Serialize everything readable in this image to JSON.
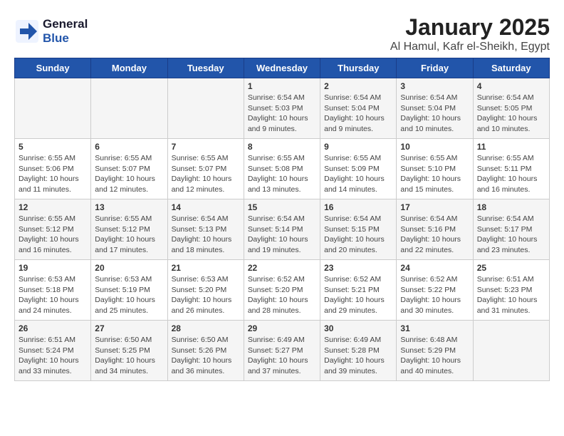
{
  "logo": {
    "general": "General",
    "blue": "Blue"
  },
  "header": {
    "title": "January 2025",
    "subtitle": "Al Hamul, Kafr el-Sheikh, Egypt"
  },
  "weekdays": [
    "Sunday",
    "Monday",
    "Tuesday",
    "Wednesday",
    "Thursday",
    "Friday",
    "Saturday"
  ],
  "weeks": [
    [
      {
        "day": "",
        "info": ""
      },
      {
        "day": "",
        "info": ""
      },
      {
        "day": "",
        "info": ""
      },
      {
        "day": "1",
        "info": "Sunrise: 6:54 AM\nSunset: 5:03 PM\nDaylight: 10 hours and 9 minutes."
      },
      {
        "day": "2",
        "info": "Sunrise: 6:54 AM\nSunset: 5:04 PM\nDaylight: 10 hours and 9 minutes."
      },
      {
        "day": "3",
        "info": "Sunrise: 6:54 AM\nSunset: 5:04 PM\nDaylight: 10 hours and 10 minutes."
      },
      {
        "day": "4",
        "info": "Sunrise: 6:54 AM\nSunset: 5:05 PM\nDaylight: 10 hours and 10 minutes."
      }
    ],
    [
      {
        "day": "5",
        "info": "Sunrise: 6:55 AM\nSunset: 5:06 PM\nDaylight: 10 hours and 11 minutes."
      },
      {
        "day": "6",
        "info": "Sunrise: 6:55 AM\nSunset: 5:07 PM\nDaylight: 10 hours and 12 minutes."
      },
      {
        "day": "7",
        "info": "Sunrise: 6:55 AM\nSunset: 5:07 PM\nDaylight: 10 hours and 12 minutes."
      },
      {
        "day": "8",
        "info": "Sunrise: 6:55 AM\nSunset: 5:08 PM\nDaylight: 10 hours and 13 minutes."
      },
      {
        "day": "9",
        "info": "Sunrise: 6:55 AM\nSunset: 5:09 PM\nDaylight: 10 hours and 14 minutes."
      },
      {
        "day": "10",
        "info": "Sunrise: 6:55 AM\nSunset: 5:10 PM\nDaylight: 10 hours and 15 minutes."
      },
      {
        "day": "11",
        "info": "Sunrise: 6:55 AM\nSunset: 5:11 PM\nDaylight: 10 hours and 16 minutes."
      }
    ],
    [
      {
        "day": "12",
        "info": "Sunrise: 6:55 AM\nSunset: 5:12 PM\nDaylight: 10 hours and 16 minutes."
      },
      {
        "day": "13",
        "info": "Sunrise: 6:55 AM\nSunset: 5:12 PM\nDaylight: 10 hours and 17 minutes."
      },
      {
        "day": "14",
        "info": "Sunrise: 6:54 AM\nSunset: 5:13 PM\nDaylight: 10 hours and 18 minutes."
      },
      {
        "day": "15",
        "info": "Sunrise: 6:54 AM\nSunset: 5:14 PM\nDaylight: 10 hours and 19 minutes."
      },
      {
        "day": "16",
        "info": "Sunrise: 6:54 AM\nSunset: 5:15 PM\nDaylight: 10 hours and 20 minutes."
      },
      {
        "day": "17",
        "info": "Sunrise: 6:54 AM\nSunset: 5:16 PM\nDaylight: 10 hours and 22 minutes."
      },
      {
        "day": "18",
        "info": "Sunrise: 6:54 AM\nSunset: 5:17 PM\nDaylight: 10 hours and 23 minutes."
      }
    ],
    [
      {
        "day": "19",
        "info": "Sunrise: 6:53 AM\nSunset: 5:18 PM\nDaylight: 10 hours and 24 minutes."
      },
      {
        "day": "20",
        "info": "Sunrise: 6:53 AM\nSunset: 5:19 PM\nDaylight: 10 hours and 25 minutes."
      },
      {
        "day": "21",
        "info": "Sunrise: 6:53 AM\nSunset: 5:20 PM\nDaylight: 10 hours and 26 minutes."
      },
      {
        "day": "22",
        "info": "Sunrise: 6:52 AM\nSunset: 5:20 PM\nDaylight: 10 hours and 28 minutes."
      },
      {
        "day": "23",
        "info": "Sunrise: 6:52 AM\nSunset: 5:21 PM\nDaylight: 10 hours and 29 minutes."
      },
      {
        "day": "24",
        "info": "Sunrise: 6:52 AM\nSunset: 5:22 PM\nDaylight: 10 hours and 30 minutes."
      },
      {
        "day": "25",
        "info": "Sunrise: 6:51 AM\nSunset: 5:23 PM\nDaylight: 10 hours and 31 minutes."
      }
    ],
    [
      {
        "day": "26",
        "info": "Sunrise: 6:51 AM\nSunset: 5:24 PM\nDaylight: 10 hours and 33 minutes."
      },
      {
        "day": "27",
        "info": "Sunrise: 6:50 AM\nSunset: 5:25 PM\nDaylight: 10 hours and 34 minutes."
      },
      {
        "day": "28",
        "info": "Sunrise: 6:50 AM\nSunset: 5:26 PM\nDaylight: 10 hours and 36 minutes."
      },
      {
        "day": "29",
        "info": "Sunrise: 6:49 AM\nSunset: 5:27 PM\nDaylight: 10 hours and 37 minutes."
      },
      {
        "day": "30",
        "info": "Sunrise: 6:49 AM\nSunset: 5:28 PM\nDaylight: 10 hours and 39 minutes."
      },
      {
        "day": "31",
        "info": "Sunrise: 6:48 AM\nSunset: 5:29 PM\nDaylight: 10 hours and 40 minutes."
      },
      {
        "day": "",
        "info": ""
      }
    ]
  ]
}
